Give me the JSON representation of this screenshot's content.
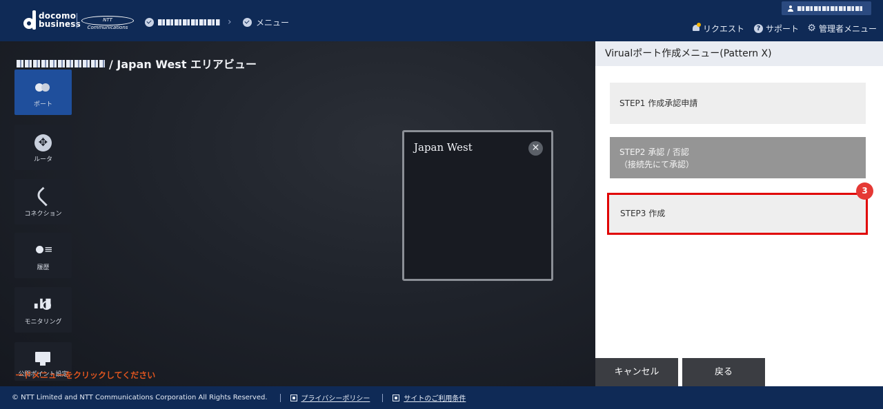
{
  "header": {
    "brand_line1": "docomo",
    "brand_line2": "business",
    "partner_logo": "NTT Communications",
    "breadcrumb": [
      {
        "label": "",
        "icon": "check-circle-icon"
      },
      {
        "label": "メニュー",
        "icon": "check-circle-icon"
      }
    ],
    "user_name": "",
    "menu": [
      {
        "label": "リクエスト",
        "icon": "bell-icon"
      },
      {
        "label": "サポート",
        "icon": "help-icon"
      },
      {
        "label": "管理者メニュー",
        "icon": "gear-icon"
      }
    ]
  },
  "main": {
    "title_suffix": "/ Japan West エリアビュー",
    "sidebar": [
      {
        "label": "ポート",
        "icon": "port-icon",
        "active": true
      },
      {
        "label": "ルータ",
        "icon": "router-icon"
      },
      {
        "label": "コネクション",
        "icon": "connection-icon"
      },
      {
        "label": "履歴",
        "icon": "history-icon"
      },
      {
        "label": "モニタリング",
        "icon": "monitoring-icon"
      },
      {
        "label": "公開ポイント設定",
        "icon": "public-point-icon"
      }
    ],
    "hint": "ードメニューをクリックしてください",
    "region_box": {
      "title": "Japan West",
      "close_label": "✕"
    }
  },
  "panel": {
    "title": "Virualポート作成メニュー(Pattern X)",
    "steps": [
      {
        "label": "STEP1 作成承認申請",
        "sub": ""
      },
      {
        "label": "STEP2 承認 / 否認",
        "sub": "（接続先にて承認）"
      },
      {
        "label": "STEP3 作成",
        "sub": ""
      }
    ],
    "badge": "3",
    "cancel_label": "キャンセル",
    "back_label": "戻る"
  },
  "footer": {
    "copyright": "© NTT Limited and NTT Communications Corporation All Rights Reserved.",
    "privacy_label": "プライバシーポリシー",
    "terms_label": "サイトのご利用条件"
  },
  "colors": {
    "header_bg": "#0f2a56",
    "active_item": "#1f4f9c",
    "highlight_border": "#e00000",
    "hint_text": "#e0551f"
  }
}
